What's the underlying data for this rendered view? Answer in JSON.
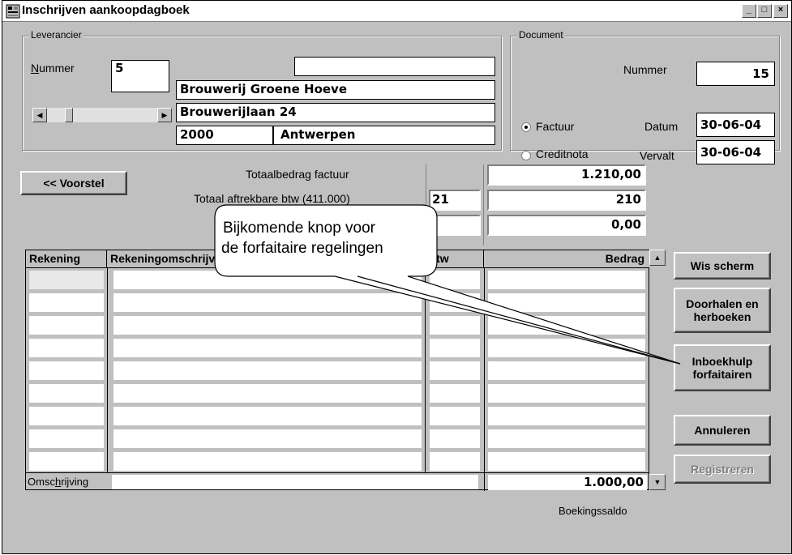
{
  "window": {
    "title": "Inschrijven aankoopdagboek",
    "minimize_label": "_",
    "maximize_label": "□",
    "close_label": "×"
  },
  "leverancier": {
    "group_label": "Leverancier",
    "nummer_label": "Nummer",
    "nummer_value": "5",
    "extra_value": "",
    "name": "Brouwerij Groene Hoeve",
    "street": "Brouwerijlaan 24",
    "postcode": "2000",
    "city": "Antwerpen"
  },
  "document": {
    "group_label": "Document",
    "nummer_label": "Nummer",
    "nummer_value": "15",
    "factuur_label": "Factuur",
    "creditnota_label": "Creditnota",
    "selected": "factuur",
    "datum_label": "Datum",
    "datum_value": "30-06-04",
    "vervalt_label": "Vervalt",
    "vervalt_value": "30-06-04"
  },
  "totals": {
    "voorstel_button": "<< Voorstel",
    "totaalbedrag_label": "Totaalbedrag factuur",
    "totaalbedrag_value": "1.210,00",
    "aftrekbare_label": "Totaal aftrekbare btw  (411.000)",
    "aftrekbare_pct": "21",
    "aftrekbare_value": "210",
    "third_value": "0,00"
  },
  "grid": {
    "headers": [
      "Rekening",
      "Rekeningomschrijving",
      "Btw",
      "Bedrag"
    ],
    "omschrijving_label": "Omschrijving",
    "omschrijving_value": "",
    "saldo_value": "1.000,00",
    "saldo_label": "Boekingssaldo"
  },
  "buttons": {
    "wis_scherm": "Wis scherm",
    "doorhalen_line1": "Doorhalen en",
    "doorhalen_line2": "herboeken",
    "inboekhulp_line1": "Inboekhulp",
    "inboekhulp_line2": "forfaitairen",
    "annuleren": "Annuleren",
    "registreren": "Registreren"
  },
  "callout": {
    "line1": "Bijkomende knop voor",
    "line2": "de forfaitaire regelingen"
  },
  "icons": {
    "window_icon": "app-window-icon",
    "scroll_left": "arrow-left-icon",
    "scroll_right": "arrow-right-icon",
    "scroll_up": "arrow-up-icon",
    "scroll_down": "arrow-down-icon"
  }
}
